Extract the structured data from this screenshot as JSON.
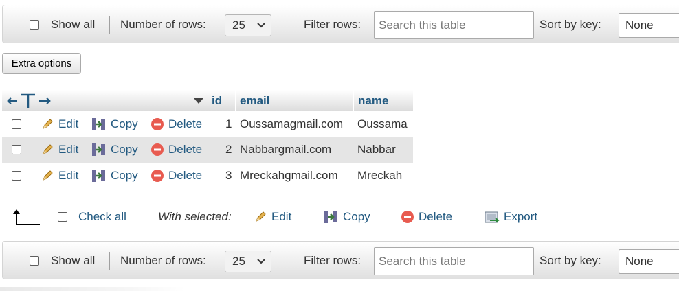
{
  "navigation_top": {
    "show_all_label": "Show all",
    "rows_label": "Number of rows:",
    "rows_value": "25",
    "filter_label": "Filter rows:",
    "filter_placeholder": "Search this table",
    "sort_label": "Sort by key:",
    "sort_value": "None"
  },
  "navigation_bottom": {
    "show_all_label": "Show all",
    "rows_label": "Number of rows:",
    "rows_value": "25",
    "filter_label": "Filter rows:",
    "filter_placeholder": "Search this table",
    "sort_label": "Sort by key:",
    "sort_value": "None"
  },
  "extra_options_label": "Extra options",
  "table": {
    "columns": [
      "id",
      "email",
      "name"
    ],
    "action_labels": {
      "edit": "Edit",
      "copy": "Copy",
      "delete": "Delete"
    },
    "rows": [
      {
        "id": "1",
        "email": "Oussamagmail.com",
        "name": "Oussama"
      },
      {
        "id": "2",
        "email": "Nabbargmail.com",
        "name": "Nabbar"
      },
      {
        "id": "3",
        "email": "Mreckahgmail.com",
        "name": "Mreckah"
      }
    ]
  },
  "bulk": {
    "check_all_label": "Check all",
    "with_selected_label": "With selected:",
    "edit_label": "Edit",
    "copy_label": "Copy",
    "delete_label": "Delete",
    "export_label": "Export"
  },
  "colors": {
    "link": "#235a81",
    "delete_icon": "#e85b50",
    "pencil": "#e6b450"
  }
}
